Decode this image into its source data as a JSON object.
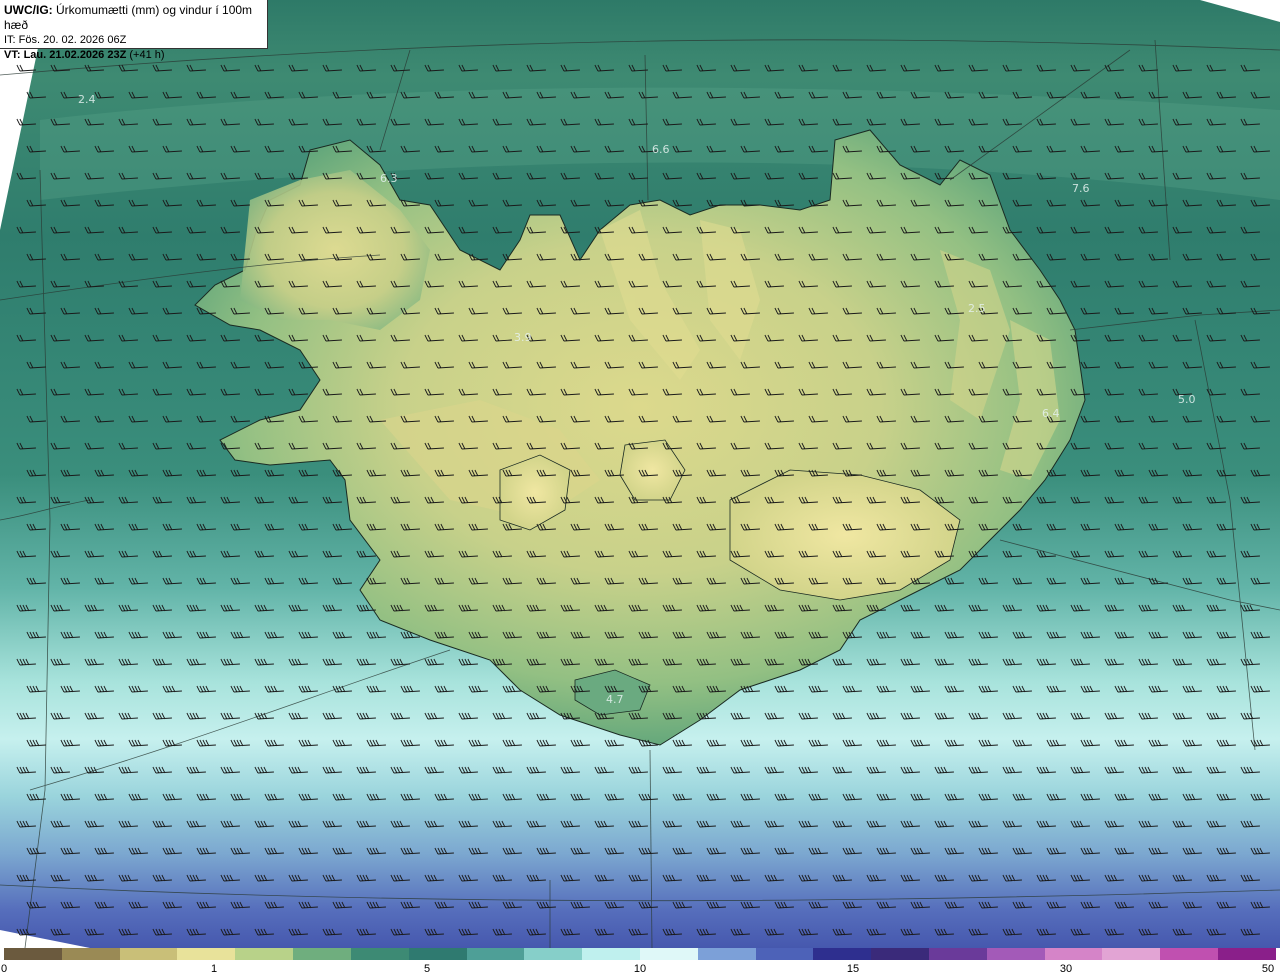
{
  "header": {
    "model": "UWC/IG:",
    "product": "Úrkomumætti (mm) og vindur í 100m hæð",
    "issue_line": "IT: Fös. 20. 02. 2026 06Z",
    "valid_prefix": "VT:",
    "valid_time": "Lau. 21.02.2026 23Z",
    "lead": "(+41 h)"
  },
  "values": [
    "2.4",
    "6.3",
    "6.6",
    "7.6",
    "3.9",
    "2.5",
    "6.4",
    "5.0",
    "4.7"
  ],
  "colorbar": {
    "ticks": [
      "0",
      "1",
      "5",
      "10",
      "15",
      "30",
      "50"
    ],
    "colors": [
      "#6b5a3e",
      "#9a8a55",
      "#c9bf78",
      "#e8e29a",
      "#b8d289",
      "#6fae7e",
      "#3d8a74",
      "#2f7a70",
      "#4e9f97",
      "#86cfc9",
      "#bff0ee",
      "#dff8f8",
      "#7ca0d8",
      "#4d62b8",
      "#2e2f8f",
      "#3a2a7a",
      "#6a3a9a",
      "#a35ab8",
      "#d584c8",
      "#e2a4d4",
      "#c050b0",
      "#8a1f8a"
    ]
  },
  "colors": {
    "land_light": "#d7d888",
    "land_mid": "#9cc484",
    "sea_dark": "#2f7a6c",
    "sea_light": "#b8ece6",
    "south_blue": "#5068b8"
  }
}
